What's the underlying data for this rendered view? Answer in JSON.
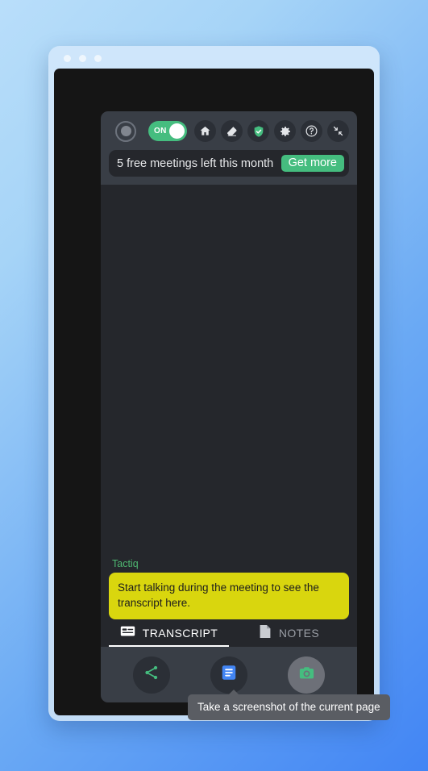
{
  "window": {
    "dots": [
      "dot-1",
      "dot-2",
      "dot-3"
    ]
  },
  "toolbar": {
    "record_icon": "record-circle-icon",
    "toggle": {
      "label": "ON",
      "state": "on",
      "color": "#45bd7f"
    },
    "icons": [
      {
        "name": "home-icon",
        "label": "Home"
      },
      {
        "name": "eraser-icon",
        "label": "Clear"
      },
      {
        "name": "shield-check-icon",
        "label": "Privacy",
        "color": "#45bd7f"
      },
      {
        "name": "gear-icon",
        "label": "Settings"
      },
      {
        "name": "help-circle-icon",
        "label": "Help"
      },
      {
        "name": "collapse-arrows-icon",
        "label": "Collapse"
      }
    ]
  },
  "banner": {
    "text": "5 free meetings left this month",
    "button_label": "Get more",
    "button_color": "#45bd7f"
  },
  "transcript": {
    "speaker": "Tactiq",
    "speaker_color": "#4eb771",
    "callout_text": "Start talking during the meeting to see the transcript here.",
    "callout_color": "#d9d60e"
  },
  "tabs": [
    {
      "label": "TRANSCRIPT",
      "icon": "transcript-icon",
      "active": true
    },
    {
      "label": "NOTES",
      "icon": "notes-page-icon",
      "active": false
    }
  ],
  "actions": [
    {
      "name": "share-button",
      "icon": "share-icon",
      "color": "#45bd7f"
    },
    {
      "name": "docs-button",
      "icon": "google-docs-icon",
      "color": "#4285f4"
    },
    {
      "name": "screenshot-button",
      "icon": "camera-icon",
      "color": "#45bd7f",
      "hovered": true
    }
  ],
  "tooltip": {
    "text": "Take a screenshot of the current page"
  }
}
